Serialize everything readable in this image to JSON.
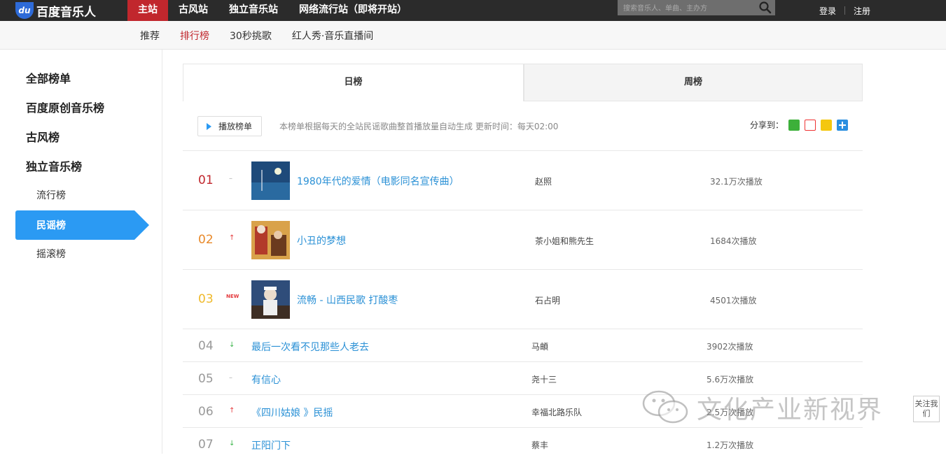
{
  "topbar": {
    "logo_badge": "du",
    "logo_text": "百度音乐人",
    "nav": [
      "主站",
      "古风站",
      "独立音乐站",
      "网络流行站（即将开站）"
    ],
    "search_placeholder": "搜索音乐人、单曲、主办方",
    "login": "登录",
    "register": "注册"
  },
  "subnav": [
    "推荐",
    "排行榜",
    "30秒挑歌",
    "红人秀·音乐直播间"
  ],
  "sidebar": {
    "headings": [
      "全部榜单",
      "百度原创音乐榜",
      "古风榜",
      "独立音乐榜"
    ],
    "subitems": [
      "流行榜",
      "民谣榜",
      "摇滚榜"
    ]
  },
  "tabs": {
    "day": "日榜",
    "week": "周榜"
  },
  "toolbar": {
    "play_label": "播放榜单",
    "desc": "本榜单根据每天的全站民谣歌曲整首播放量自动生成 更新时间：每天02:00",
    "share_label": "分享到："
  },
  "songs": [
    {
      "rank": "01",
      "trend": "–",
      "title": "1980年代的爱情（电影同名宣传曲）",
      "artist": "赵照",
      "plays": "32.1万次播放"
    },
    {
      "rank": "02",
      "trend": "↑",
      "title": "小丑的梦想",
      "artist": "茶小姐和熊先生",
      "plays": "1684次播放"
    },
    {
      "rank": "03",
      "trend": "NEW",
      "title": "流畅 - 山西民歌 打酸枣",
      "artist": "石占明",
      "plays": "4501次播放"
    },
    {
      "rank": "04",
      "trend": "↓",
      "title": "最后一次看不见那些人老去",
      "artist": "马頔",
      "plays": "3902次播放"
    },
    {
      "rank": "05",
      "trend": "–",
      "title": "有信心",
      "artist": "尧十三",
      "plays": "5.6万次播放"
    },
    {
      "rank": "06",
      "trend": "↑",
      "title": "《四川姑娘 》民摇",
      "artist": "幸福北路乐队",
      "plays": "2.5万次播放"
    },
    {
      "rank": "07",
      "trend": "↓",
      "title": "正阳门下",
      "artist": "蔡丰",
      "plays": "1.2万次播放"
    }
  ],
  "watermark": {
    "text": "文化产业新视界",
    "follow": "关注我们"
  },
  "colors": {
    "accent_red": "#c1272d",
    "sidebar_active": "#2b9af3",
    "link_blue": "#2b91d6"
  }
}
